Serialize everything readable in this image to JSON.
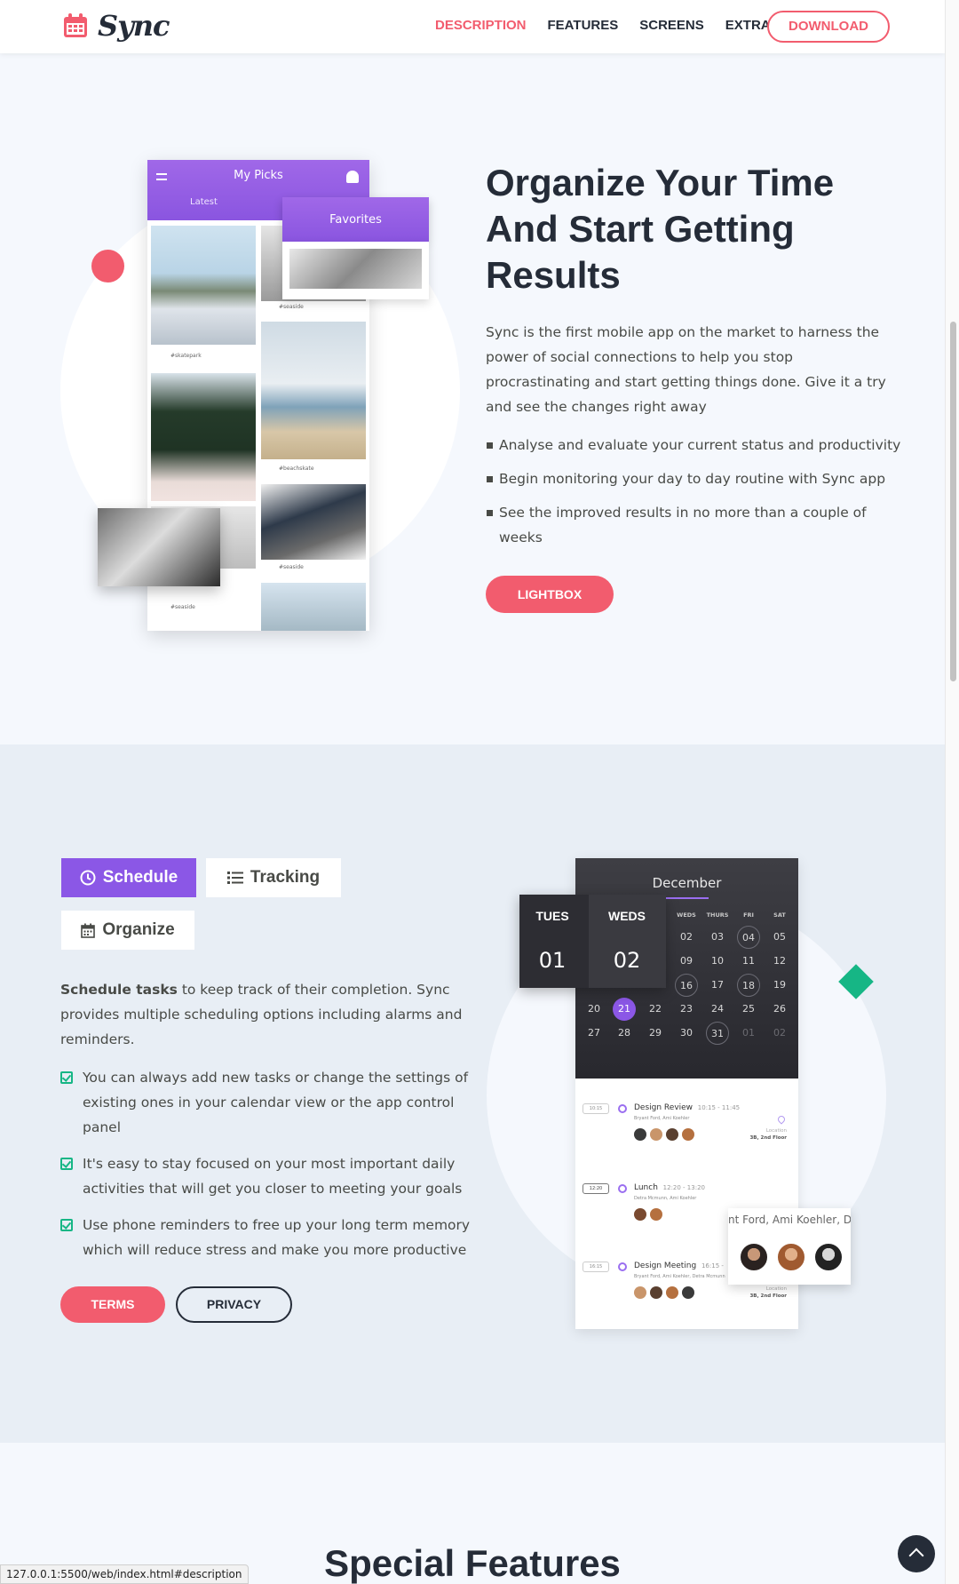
{
  "nav": {
    "brand": "Sync",
    "links": [
      {
        "label": "DESCRIPTION",
        "active": true
      },
      {
        "label": "FEATURES"
      },
      {
        "label": "SCREENS"
      },
      {
        "label": "EXTRA"
      }
    ],
    "download_label": "DOWNLOAD"
  },
  "colors": {
    "accent": "#f25c6e",
    "purple": "#8b57e6",
    "green": "#16b685",
    "dark": "#252c38"
  },
  "hero": {
    "title": "Organize Your Time And Start Getting Results",
    "description": "Sync is the first mobile app on the market to harness the power of social connections to help you stop procrastinating and start getting things done. Give it a try and see the changes right away",
    "bullets": [
      "Analyse and evaluate your current status and productivity",
      "Begin monitoring your day to day routine with Sync app",
      "See the improved results in no more than a couple of weeks"
    ],
    "button_label": "LIGHTBOX",
    "phone": {
      "title": "My Picks",
      "tab_latest": "Latest",
      "tab_favorites": "Favorites",
      "captions": [
        "#skatepark",
        "#seaside",
        "#beachskate",
        "#seaside",
        "#seaside"
      ]
    }
  },
  "schedule": {
    "tabs": [
      {
        "label": "Schedule",
        "icon": "clock-icon",
        "active": true
      },
      {
        "label": "Tracking",
        "icon": "list-icon"
      },
      {
        "label": "Organize",
        "icon": "calendar-icon"
      }
    ],
    "lead_bold": "Schedule tasks",
    "lead_rest": " to keep track of their completion. Sync provides multiple scheduling options including alarms and reminders.",
    "items": [
      "You can always add new tasks or change the settings of existing ones in your calendar view or the app control panel",
      "It's easy to stay focused on your most important daily activities that will get you closer to meeting your goals",
      "Use phone reminders to free up your long term memory which will reduce stress and make you more productive"
    ],
    "terms_label": "TERMS",
    "privacy_label": "PRIVACY",
    "calendar": {
      "month": "December",
      "dow": [
        "WEDS",
        "THURS",
        "FRI",
        "SAT"
      ],
      "big_days": [
        {
          "label": "TUES",
          "num": "01"
        },
        {
          "label": "WEDS",
          "num": "02"
        }
      ],
      "rows": [
        [
          "02",
          "03",
          "04",
          "05"
        ],
        [
          "09",
          "10",
          "11",
          "12"
        ],
        [
          "16",
          "17",
          "18",
          "19"
        ],
        [
          "20",
          "21",
          "22",
          "23",
          "24",
          "25",
          "26"
        ],
        [
          "27",
          "28",
          "29",
          "30",
          "31",
          "01",
          "02"
        ]
      ],
      "events": [
        {
          "time": "10:15",
          "title": "Design Review",
          "range": "10:15 - 11:45",
          "people": "Bryant Ford, Ami Koehler",
          "location": "Location",
          "room": "3B, 2nd Floor"
        },
        {
          "time": "12:20",
          "title": "Lunch",
          "range": "12:20 - 13:20",
          "people": "Detra Mcmunn, Ami Koehler"
        },
        {
          "time": "16:15",
          "title": "Design Meeting",
          "range": "16:15 -",
          "people": "Bryant Ford, Ami Koehler, Detra Mcmunn",
          "location": "Location",
          "room": "3B, 2nd Floor"
        }
      ],
      "people_card_text": "nt Ford, Ami Koehler, Det"
    }
  },
  "features": {
    "title": "Special Features"
  },
  "status_url": "127.0.0.1:5500/web/index.html#description"
}
